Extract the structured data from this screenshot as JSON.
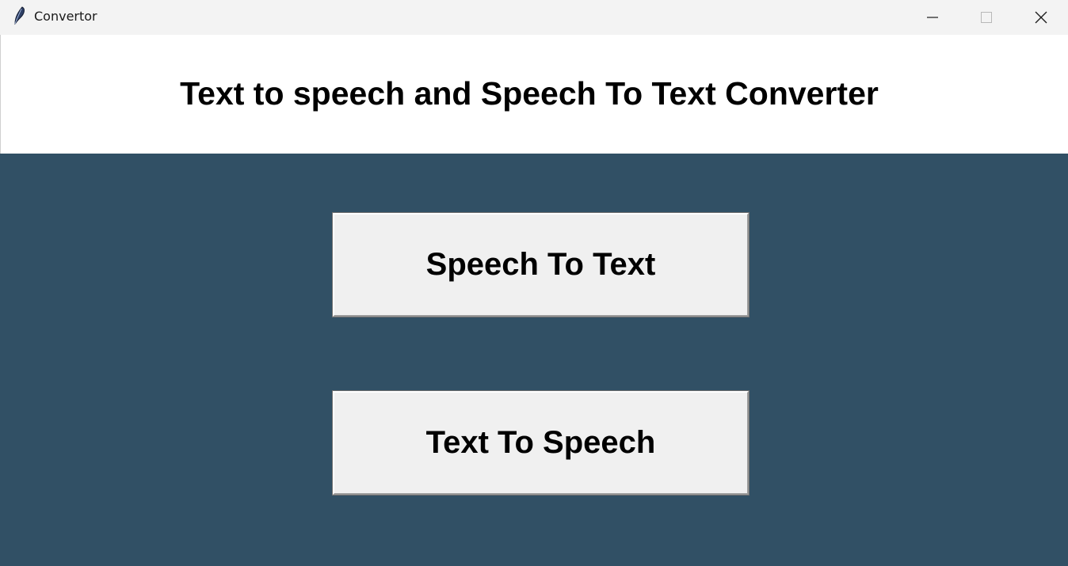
{
  "window": {
    "title": "Convertor",
    "icon": "feather-icon",
    "controls": {
      "minimize": "minimize-icon",
      "maximize": "maximize-icon",
      "close": "close-icon"
    }
  },
  "header": {
    "title": "Text to speech and Speech To Text Converter"
  },
  "main": {
    "speech_to_text_label": "Speech To Text",
    "text_to_speech_label": "Text To Speech"
  },
  "colors": {
    "titlebar": "#f3f3f3",
    "content_background": "#315065",
    "button_face": "#f0f0f0"
  }
}
